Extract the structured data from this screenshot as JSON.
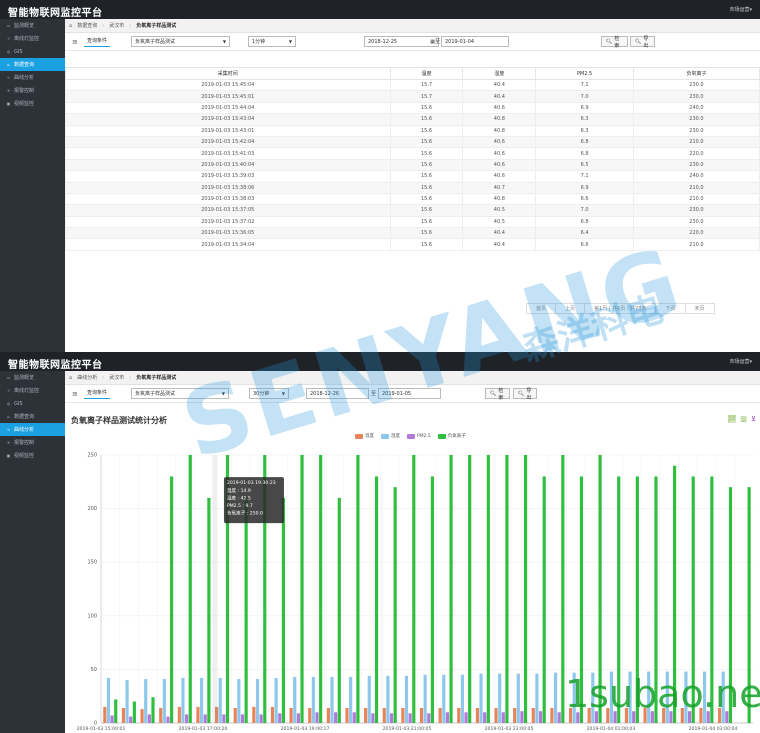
{
  "app": {
    "title": "智能物联网监控平台",
    "user": "市场运营▾"
  },
  "sidebar": {
    "items": [
      {
        "label": "监测概览",
        "icon": "display-icon"
      },
      {
        "label": "离线灯监控",
        "icon": "bulb-icon"
      },
      {
        "label": "GIS",
        "icon": "map-icon"
      },
      {
        "label": "数据查询",
        "icon": "database-icon"
      },
      {
        "label": "曲线分析",
        "icon": "chart-icon"
      },
      {
        "label": "报警控制",
        "icon": "alarm-icon"
      },
      {
        "label": "视频监控",
        "icon": "video-icon"
      }
    ]
  },
  "screen1": {
    "breadcrumb": [
      "数据查询",
      "武汉市",
      "负氧离子样品测试"
    ],
    "toolbar": {
      "query_label": "查询条件",
      "sample": "负氧离子样品测试",
      "interval": "1分钟",
      "start_date": "2018-12-25",
      "to": "至",
      "end_date": "2019-01-04",
      "search": "检索",
      "export": "导出"
    },
    "table": {
      "columns": [
        "采集时间",
        "温度",
        "湿度",
        "PM2.5",
        "负氧离子"
      ],
      "rows": [
        [
          "2019-01-03 15:45:04",
          "15.7",
          "40.4",
          "7.1",
          "230.0"
        ],
        [
          "2019-01-03 15:45:01",
          "15.7",
          "40.4",
          "7.0",
          "230.0"
        ],
        [
          "2019-01-03 15:44:04",
          "15.6",
          "40.6",
          "6.9",
          "240.0"
        ],
        [
          "2019-01-03 15:43:04",
          "15.6",
          "40.8",
          "6.3",
          "230.0"
        ],
        [
          "2019-01-03 15:43:01",
          "15.6",
          "40.8",
          "6.3",
          "230.0"
        ],
        [
          "2019-01-03 15:42:04",
          "15.6",
          "40.6",
          "6.8",
          "210.0"
        ],
        [
          "2019-01-03 15:41:03",
          "15.6",
          "40.6",
          "6.8",
          "220.0"
        ],
        [
          "2019-01-03 15:40:04",
          "15.6",
          "40.6",
          "6.5",
          "230.0"
        ],
        [
          "2019-01-03 15:39:03",
          "15.6",
          "40.6",
          "7.1",
          "240.0"
        ],
        [
          "2019-01-03 15:38:06",
          "15.6",
          "40.7",
          "6.9",
          "210.0"
        ],
        [
          "2019-01-03 15:38:03",
          "15.6",
          "40.8",
          "6.6",
          "210.0"
        ],
        [
          "2019-01-03 15:37:05",
          "15.6",
          "40.5",
          "7.0",
          "230.0"
        ],
        [
          "2019-01-03 15:37:02",
          "15.6",
          "40.5",
          "6.8",
          "230.0"
        ],
        [
          "2019-01-03 15:36:05",
          "15.6",
          "40.4",
          "6.4",
          "220.0"
        ],
        [
          "2019-01-03 15:34:04",
          "15.6",
          "40.4",
          "6.6",
          "210.0"
        ]
      ]
    },
    "pager": [
      "首页",
      "上页",
      "第1页 | 共6页 / 共78条",
      "下页",
      "末页"
    ]
  },
  "screen2": {
    "breadcrumb": [
      "曲线分析",
      "武汉市",
      "负氧离子样品测试"
    ],
    "toolbar": {
      "query_label": "查询条件",
      "sample": "负氧离子样品测试",
      "interval": "30分钟",
      "start_date": "2018-12-26",
      "to": "至",
      "end_date": "2019-01-05",
      "search": "检索",
      "export": "导出"
    },
    "chart_title": "负氧离子样品测试统计分析"
  },
  "chart_data": {
    "type": "bar",
    "title": "负氧离子样品测试统计分析",
    "ylim": [
      0,
      250
    ],
    "yticks": [
      0,
      50,
      100,
      150,
      200,
      250
    ],
    "grid": true,
    "legend": "top-center",
    "x_tick_labels": [
      "2019-01-03 15:00:01",
      "2019-01-03 17:00:20",
      "2019-01-03 19:00:17",
      "2019-01-03 21:00:05",
      "2019-01-03 23:00:05",
      "2019-01-04 01:00:03",
      "2019-01-04 03:00:04"
    ],
    "series": [
      {
        "name": "温度",
        "color": "#e8845a",
        "values": [
          15,
          14,
          13,
          14,
          15,
          15,
          15,
          14,
          15,
          15,
          14,
          14,
          14,
          14,
          14,
          14,
          14,
          14,
          14,
          14,
          14,
          14,
          14,
          14,
          14,
          14,
          14,
          14,
          14,
          14,
          14,
          14,
          14,
          14
        ]
      },
      {
        "name": "湿度",
        "color": "#8dc8ec",
        "values": [
          42,
          40,
          41,
          41,
          42,
          42,
          42,
          41,
          41,
          42,
          43,
          43,
          43,
          43,
          44,
          44,
          44,
          45,
          45,
          45,
          46,
          46,
          46,
          46,
          47,
          47,
          47,
          48,
          48,
          48,
          48,
          48,
          48,
          48
        ]
      },
      {
        "name": "PM2.5",
        "color": "#b07ad6",
        "values": [
          7,
          6,
          8,
          6,
          8,
          8,
          8,
          8,
          8,
          9,
          9,
          10,
          10,
          10,
          9,
          9,
          9,
          9,
          10,
          10,
          10,
          10,
          11,
          11,
          10,
          10,
          11,
          11,
          11,
          11,
          11,
          11,
          11,
          11
        ]
      },
      {
        "name": "负氧离子",
        "color": "#2fbf3f",
        "values": [
          22,
          20,
          24,
          230,
          250,
          210,
          250,
          210,
          250,
          210,
          250,
          250,
          210,
          250,
          230,
          220,
          250,
          230,
          250,
          250,
          250,
          250,
          250,
          230,
          250,
          230,
          250,
          230,
          230,
          230,
          240,
          230,
          230,
          220,
          220
        ]
      }
    ],
    "tooltip": {
      "time": "2019-01-03 19:30:23",
      "lines": [
        "温度 : 14.9",
        "湿度 : 42.5",
        "PM2.5 : 9.7",
        "负氧离子 : 250.0"
      ]
    }
  },
  "watermarks": {
    "brand_en": "SENYANG",
    "brand_cn": "森洋科电",
    "site": "1subao.net"
  }
}
